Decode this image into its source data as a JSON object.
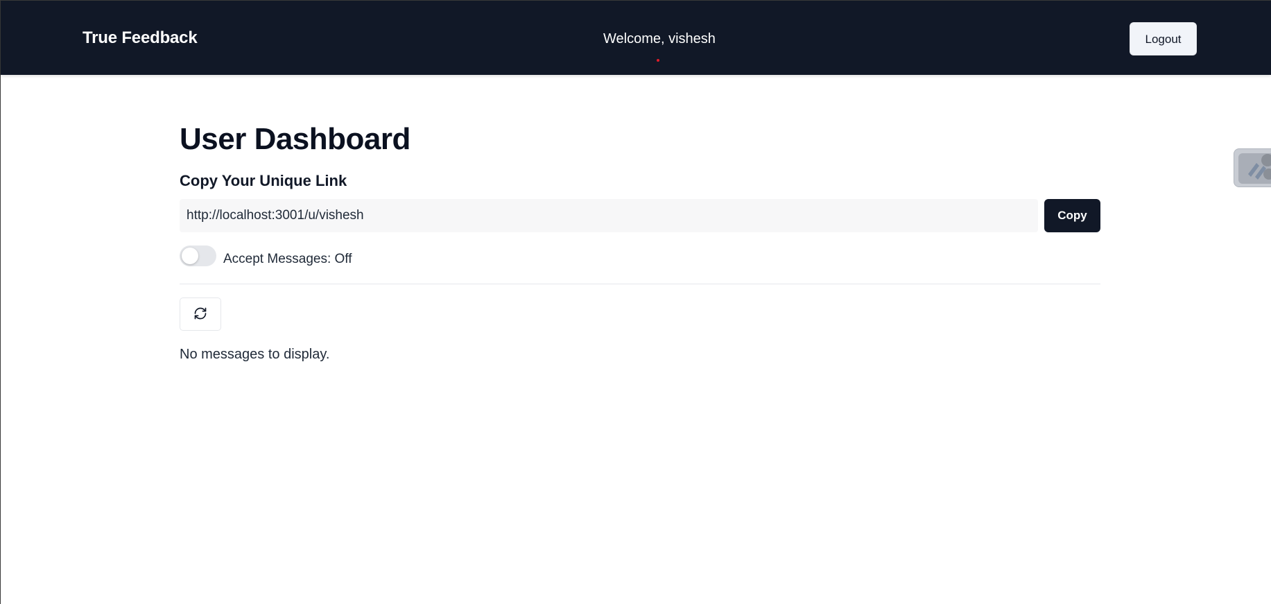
{
  "navbar": {
    "brand": "True Feedback",
    "welcome": "Welcome, vishesh",
    "logout_label": "Logout",
    "background": "#111827"
  },
  "main": {
    "title": "User Dashboard",
    "copy_section_title": "Copy Your Unique Link",
    "unique_link": "http://localhost:3001/u/vishesh",
    "copy_button_label": "Copy",
    "accept_messages": {
      "checked": false,
      "label": "Accept Messages: Off"
    },
    "refresh_icon": "refresh-icon",
    "empty_message": "No messages to display."
  },
  "side_widget": {
    "icon": "extension-widget-icon"
  },
  "colors": {
    "primary": "#111827",
    "muted_bg": "#f7f7f8",
    "switch_off": "#e5e7eb",
    "accent_dot": "#e11d2a"
  }
}
